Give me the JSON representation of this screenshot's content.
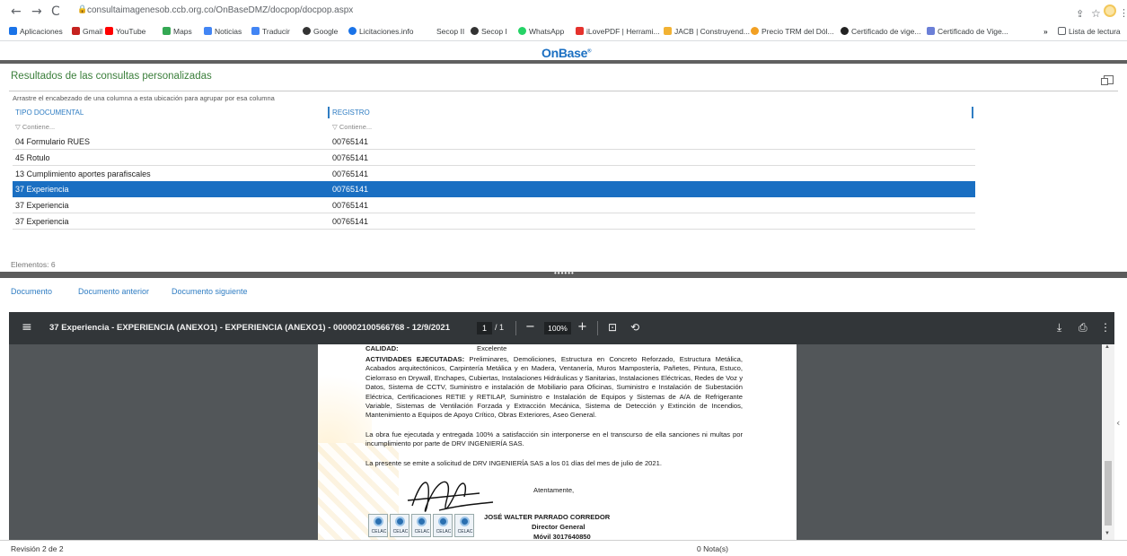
{
  "browser": {
    "url": "consultaimagenesob.ccb.org.co/OnBaseDMZ/docpop/docpop.aspx",
    "bookmarks": [
      {
        "label": "Aplicaciones",
        "color": "#1a73e8"
      },
      {
        "label": "Gmail",
        "color": "#c5221f"
      },
      {
        "label": "YouTube",
        "color": "#ff0000"
      },
      {
        "label": "Maps",
        "color": "#34a853"
      },
      {
        "label": "Noticias",
        "color": "#4285f4"
      },
      {
        "label": "Traducir",
        "color": "#4285f4"
      },
      {
        "label": "Google",
        "color": "#333333"
      },
      {
        "label": "Licitaciones.info",
        "color": "#1a73e8"
      },
      {
        "label": "Secop II",
        "color": "#888888"
      },
      {
        "label": "Secop I",
        "color": "#333333"
      },
      {
        "label": "WhatsApp",
        "color": "#25d366"
      },
      {
        "label": "iLovePDF | Herrami...",
        "color": "#e5322d"
      },
      {
        "label": "JACB | Construyend...",
        "color": "#f2b233"
      },
      {
        "label": "Precio TRM del Dól...",
        "color": "#f2a023"
      },
      {
        "label": "Certificado de vige...",
        "color": "#222222"
      },
      {
        "label": "Certificado de Vige...",
        "color": "#6b7fd7"
      },
      {
        "label": "»",
        "color": ""
      },
      {
        "label": "Lista de lectura",
        "color": "#5f6368"
      }
    ]
  },
  "app": {
    "logo": "OnBase"
  },
  "results": {
    "title": "Resultados de las consultas personalizadas",
    "group_hint": "Arrastre el encabezado de una columna a esta ubicación para agrupar por esa columna",
    "columns": [
      "TIPO DOCUMENTAL",
      "REGISTRO"
    ],
    "filter_placeholder": "Contiene...",
    "rows": [
      {
        "tipo": "04 Formulario RUES",
        "registro": "00765141",
        "selected": false
      },
      {
        "tipo": "45 Rotulo",
        "registro": "00765141",
        "selected": false
      },
      {
        "tipo": "13 Cumplimiento aportes parafiscales",
        "registro": "00765141",
        "selected": false
      },
      {
        "tipo": "37 Experiencia",
        "registro": "00765141",
        "selected": true
      },
      {
        "tipo": "37 Experiencia",
        "registro": "00765141",
        "selected": false
      },
      {
        "tipo": "37 Experiencia",
        "registro": "00765141",
        "selected": false
      }
    ],
    "count_label": "Elementos: 6"
  },
  "doc_nav": {
    "document": "Documento",
    "previous": "Documento anterior",
    "next": "Documento siguiente"
  },
  "pdf": {
    "title": "37 Experiencia - EXPERIENCIA (ANEXO1) - EXPERIENCIA (ANEXO1) - 000002100566768 - 12/9/2021",
    "page_current": "1",
    "page_total": "/ 1",
    "zoom": "100%",
    "content": {
      "calidad_label": "CALIDAD:",
      "calidad_value": "Excelente",
      "actividades_label": "ACTIVIDADES EJECUTADAS:",
      "actividades_text": "Preliminares, Demoliciones, Estructura en Concreto Reforzado, Estructura Metálica, Acabados arquitectónicos, Carpintería Metálica y en Madera, Ventanería, Muros Mampostería, Pañetes, Pintura, Estuco, Cielorraso en Drywall, Enchapes, Cubiertas, Instalaciones Hidráulicas y Sanitarias, Instalaciones Eléctricas, Redes de Voz y Datos, Sistema de CCTV, Suministro e instalación de Mobiliario para Oficinas, Suministro e Instalación de Subestación Eléctrica, Certificaciones RETIE y RETILAP, Suministro e Instalación de Equipos y Sistemas de A/A de Refrigerante Variable, Sistemas de Ventilación Forzada y Extracción Mecánica, Sistema de Detección y Extinción de Incendios, Mantenimiento a Equipos de Apoyo Crítico, Obras Exteriores, Aseo General.",
      "paragraph_1": "La obra fue ejecutada y entregada 100% a satisfacción sin interponerse en el transcurso de ella sanciones ni multas por incumplimiento por parte de DRV INGENIERÍA SAS.",
      "paragraph_2": "La presente se emite a solicitud de DRV INGENIERÍA SAS a los 01 días del mes de julio de 2021.",
      "closing": "Atentamente,",
      "signer_name": "JOSÉ WALTER PARRADO CORREDOR",
      "signer_title": "Director General",
      "signer_phone": "Móvil 3017640850",
      "logo_label": "CELAC"
    }
  },
  "footer": {
    "revision": "Revisión 2 de 2",
    "notes": "0 Nota(s)"
  }
}
